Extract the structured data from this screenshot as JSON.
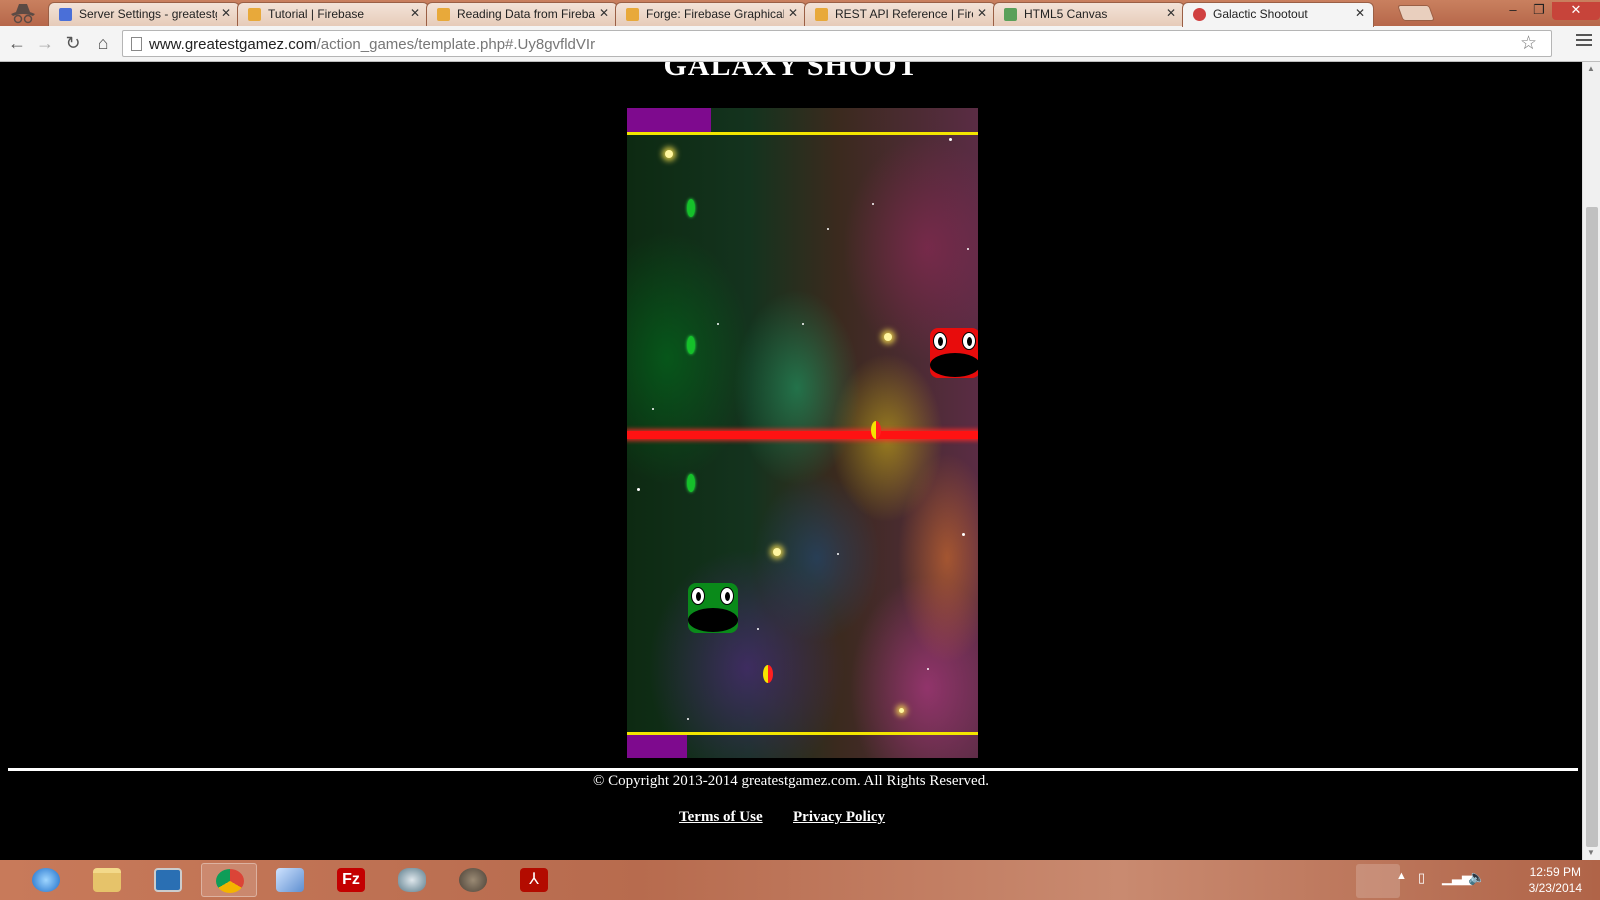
{
  "browser": {
    "tabs": [
      {
        "title": "Server Settings - greatestg",
        "favicon": "grid-favicon",
        "color": "#4a6fd8"
      },
      {
        "title": "Tutorial | Firebase",
        "favicon": "firebase-favicon",
        "color": "#e8a93a"
      },
      {
        "title": "Reading Data from Fireba",
        "favicon": "firebase-favicon",
        "color": "#e8a93a"
      },
      {
        "title": "Forge: Firebase Graphical",
        "favicon": "firebase-favicon",
        "color": "#e8a93a"
      },
      {
        "title": "REST API Reference | Fireb",
        "favicon": "firebase-favicon",
        "color": "#e8a93a"
      },
      {
        "title": "HTML5 Canvas",
        "favicon": "canvas-favicon",
        "color": "#5aa05a"
      },
      {
        "title": "Galactic Shootout",
        "favicon": "game-favicon",
        "color": "#d04040",
        "active": true
      }
    ],
    "url_host": "www.greatestgamez.com",
    "url_path": "/action_games/template.php#.Uy8gvfldVIr"
  },
  "page": {
    "title": "GALAXY SHOOT",
    "copyright": "© Copyright 2013-2014 greatestgamez.com. All Rights Reserved.",
    "links": {
      "terms": "Terms of Use",
      "privacy": "Privacy Policy"
    }
  },
  "game": {
    "player_color": "#0a8a1a",
    "enemy_color": "#e80c0c",
    "laser_color": "#ff1212",
    "hud_color": "#7e0a8e",
    "boundary_color": "#f3e600",
    "player_health_fraction": 0.17,
    "enemy_health_fraction": 0.24
  },
  "taskbar": {
    "apps": [
      "internet-explorer",
      "file-explorer",
      "remote-desktop",
      "chrome",
      "virtualbox",
      "filezilla",
      "network-tool",
      "gimp",
      "adobe-reader"
    ],
    "time": "12:59 PM",
    "date": "3/23/2014"
  }
}
